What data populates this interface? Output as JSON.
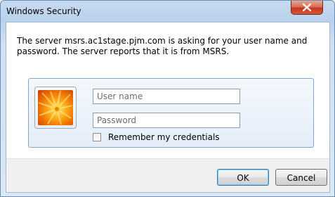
{
  "window": {
    "title": "Windows Security",
    "close_icon": "close-x-icon"
  },
  "dialog": {
    "message": "The server msrs.ac1stage.pjm.com is asking for your user name and password. The server reports that it is from MSRS.",
    "credential_tile_icon": "user-account-tile-icon",
    "username": {
      "placeholder": "User name",
      "value": ""
    },
    "password": {
      "placeholder": "Password",
      "value": ""
    },
    "remember": {
      "label": "Remember my credentials",
      "checked": false
    }
  },
  "buttons": {
    "ok_label": "OK",
    "cancel_label": "Cancel"
  },
  "colors": {
    "close_button": "#c4391f",
    "panel_border": "#84a6d4",
    "default_button_border": "#3c7fb1"
  }
}
